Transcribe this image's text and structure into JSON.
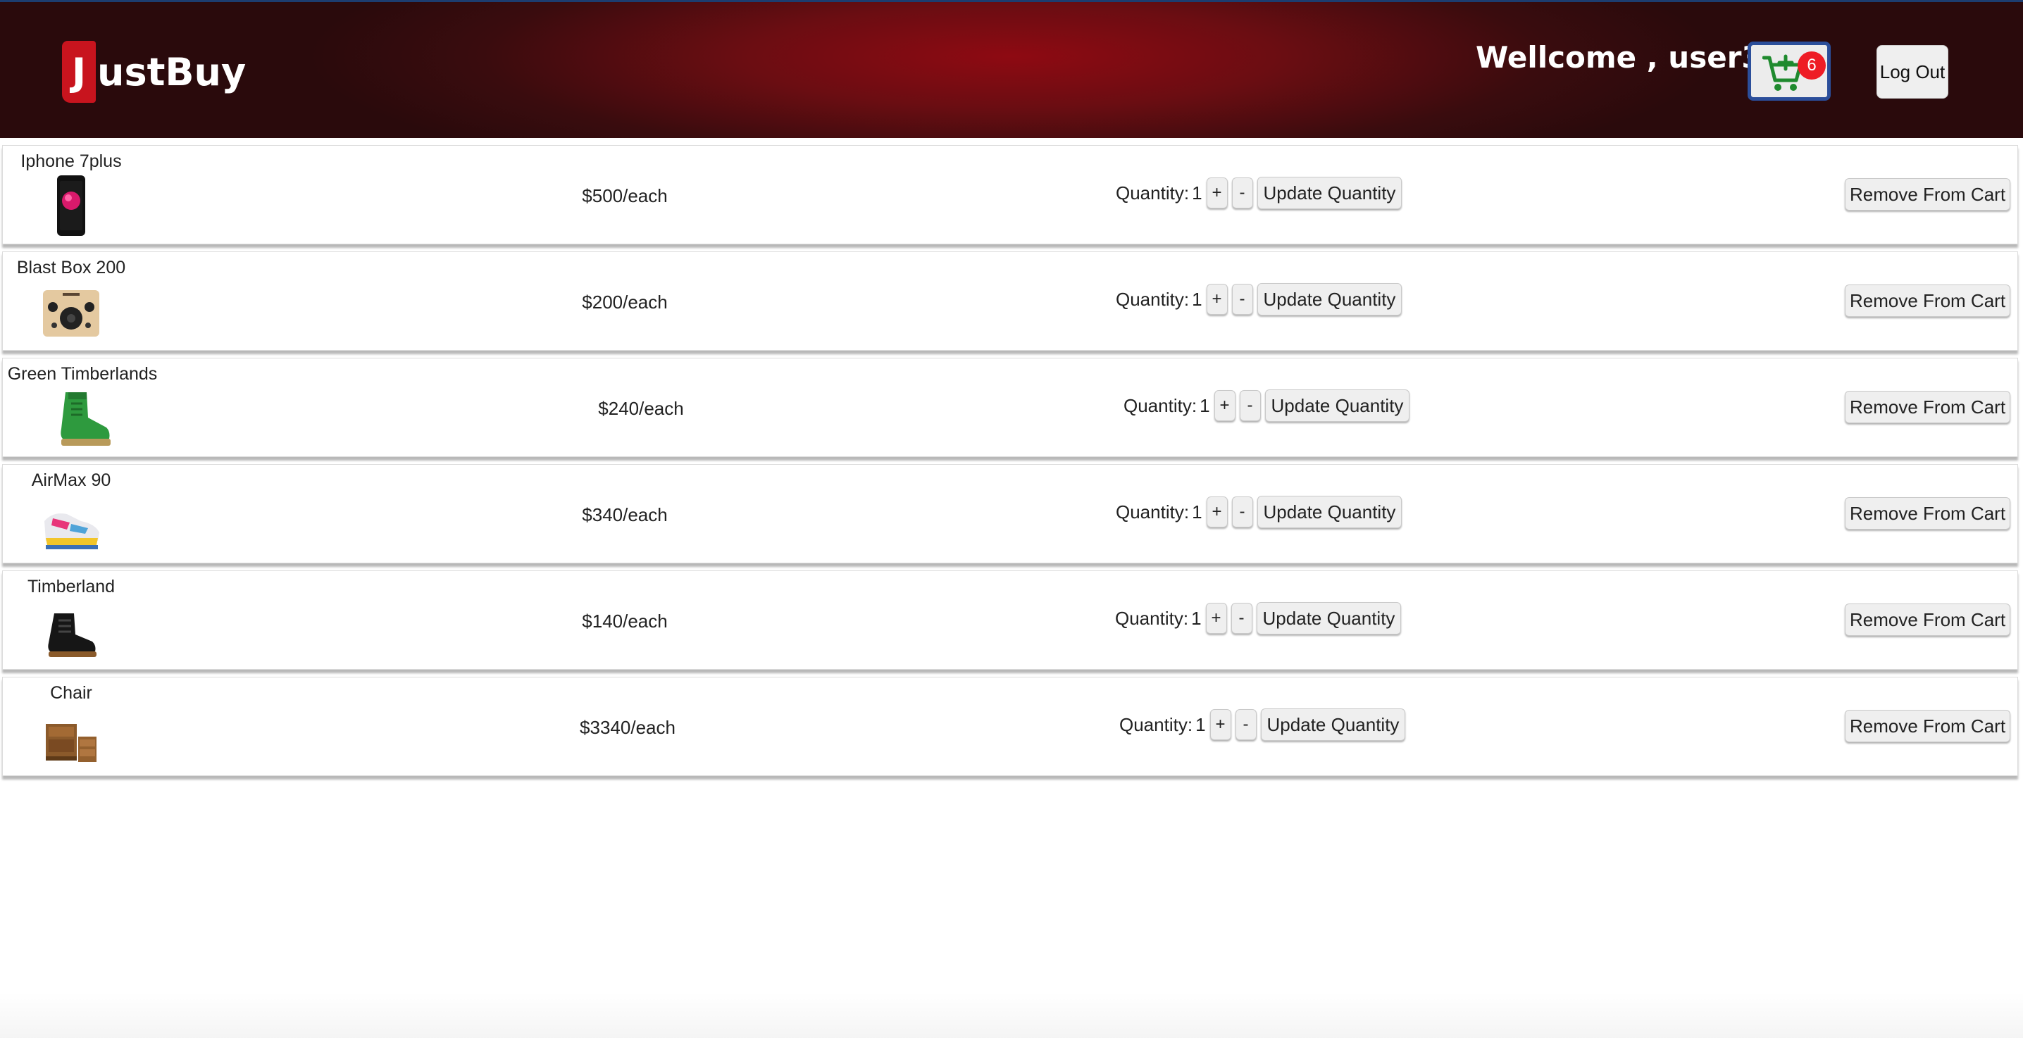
{
  "header": {
    "logo_letter": "J",
    "logo_rest": "ustBuy",
    "welcome": "Wellcome , user3",
    "cart_count": "6",
    "logout_label": "Log Out",
    "cart_icon": "cart-plus-icon"
  },
  "cart": {
    "quantity_label": "Quantity:",
    "plus_label": "+",
    "minus_label": "-",
    "update_label": "Update Quantity",
    "remove_label": "Remove From Cart",
    "items": [
      {
        "name": "Iphone 7plus",
        "price": "$500/each",
        "quantity": "1",
        "image": "phone-image"
      },
      {
        "name": "Blast Box 200",
        "price": "$200/each",
        "quantity": "1",
        "image": "speaker-image"
      },
      {
        "name": "Green Timberlands",
        "price": "$240/each",
        "quantity": "1",
        "image": "green-boot-image"
      },
      {
        "name": "AirMax 90",
        "price": "$340/each",
        "quantity": "1",
        "image": "sneaker-image"
      },
      {
        "name": "Timberland",
        "price": "$140/each",
        "quantity": "1",
        "image": "black-boot-image"
      },
      {
        "name": "Chair",
        "price": "$3340/each",
        "quantity": "1",
        "image": "furniture-image"
      }
    ]
  },
  "colors": {
    "header_red": "#8e0a12",
    "logo_red": "#c8141e",
    "badge_red": "#ee1c25",
    "cart_border": "#2b4e9a",
    "cart_green": "#1f8a2e"
  }
}
